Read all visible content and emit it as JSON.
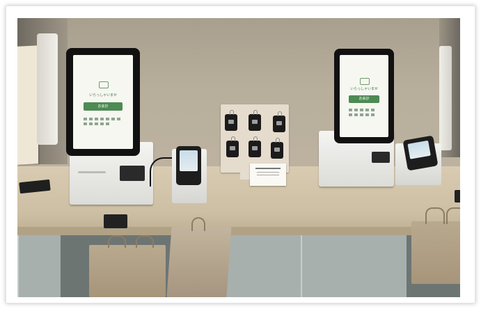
{
  "photo": {
    "subject": "self-order kiosks on a cafe counter",
    "kiosks": [
      {
        "welcome_text": "いらっしゃいませ",
        "button_text": "お会計"
      },
      {
        "welcome_text": "いらっしゃいませ",
        "button_text": "お会計"
      }
    ],
    "colors": {
      "wall": "#b8ae9c",
      "counter": "#d9cbb1",
      "cabinet": "#a8b0ad",
      "kiosk_button": "#4d8a54"
    }
  }
}
